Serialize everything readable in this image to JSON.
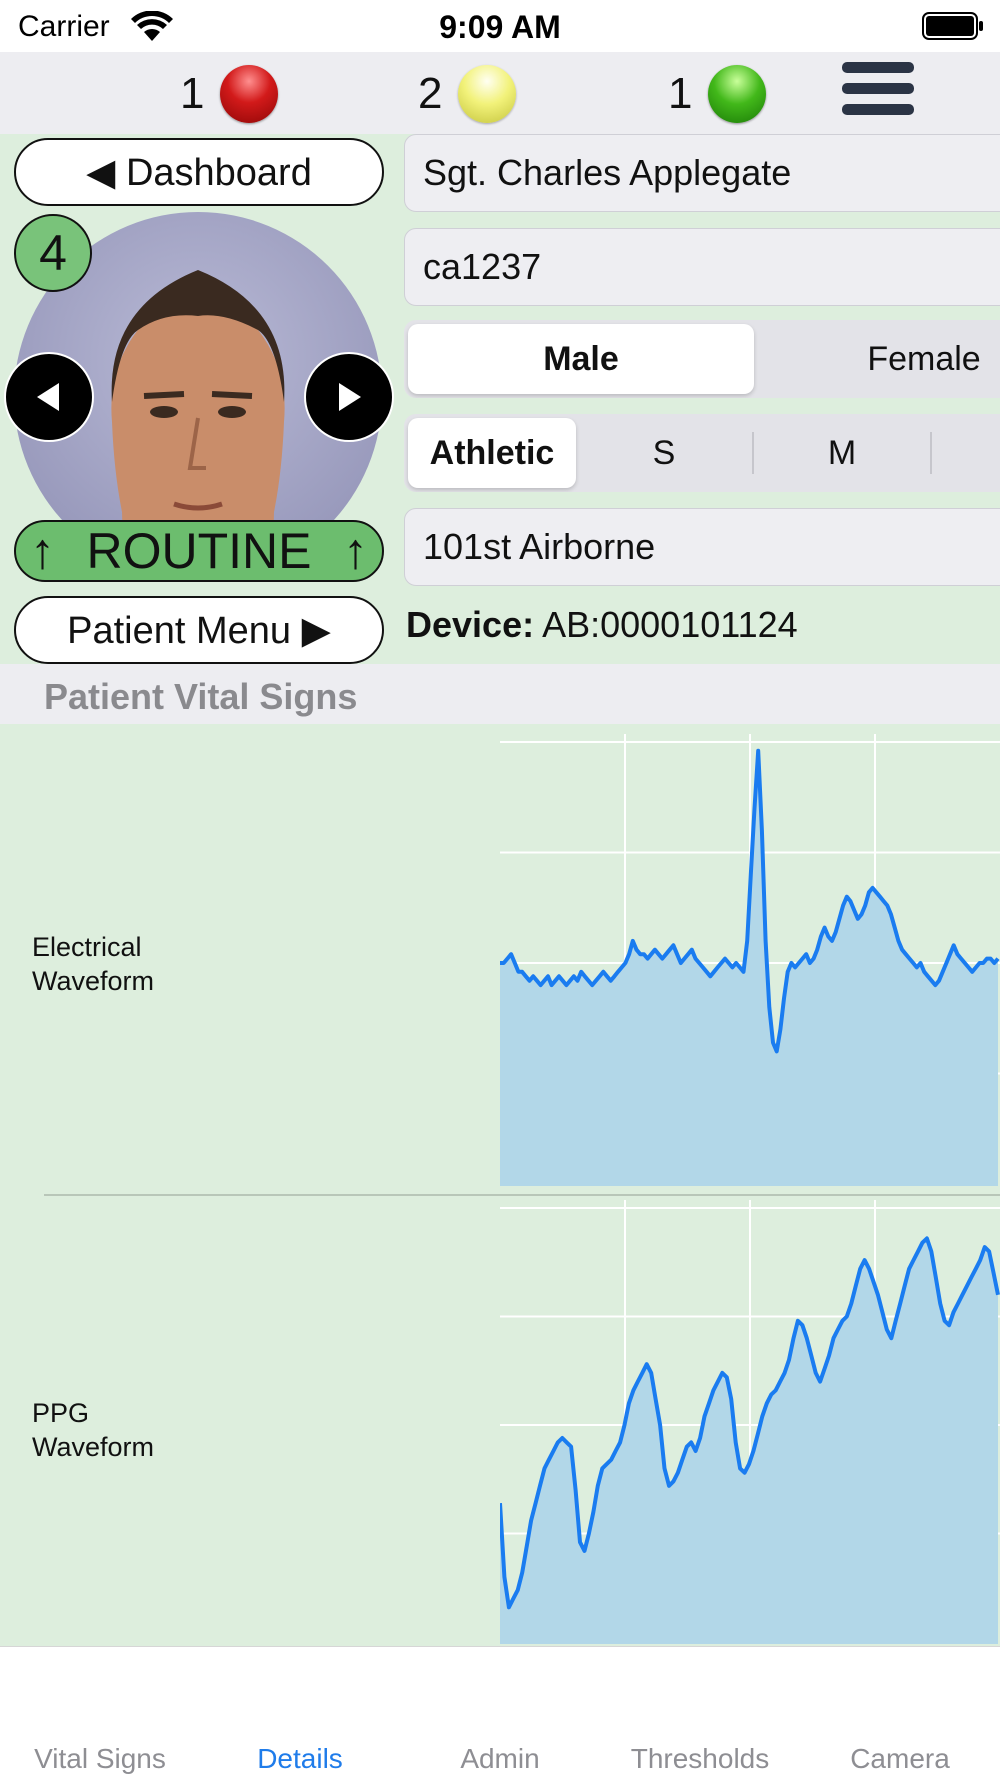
{
  "status_bar": {
    "carrier": "Carrier",
    "time": "9:09 AM"
  },
  "triage": {
    "items": [
      {
        "count": "1",
        "color": "red",
        "hex": "#d21a1a"
      },
      {
        "count": "2",
        "color": "yellow",
        "hex": "#f2f27a"
      },
      {
        "count": "1",
        "color": "green",
        "hex": "#42b81a"
      }
    ],
    "menu_icon": "hamburger-icon"
  },
  "patient": {
    "dashboard_button": "◀ Dashboard",
    "patient_count": "4",
    "prev_icon": "arrow-left-icon",
    "next_icon": "arrow-right-icon",
    "priority": {
      "arrow_left": "↑",
      "label": "ROUTINE",
      "arrow_right": "↑",
      "color": "#6cbd6e"
    },
    "menu_button": "Patient Menu ▶",
    "name": "Sgt. Charles Applegate",
    "patient_id": "ca1237",
    "sex_options": [
      "Male",
      "Female"
    ],
    "sex_selected": "Male",
    "build_options": [
      "Athletic",
      "S",
      "M"
    ],
    "build_selected": "Athletic",
    "unit": "101st Airborne",
    "device_label": "Device:",
    "device_value": "AB:0000101124"
  },
  "vitals": {
    "section_title": "Patient Vital Signs",
    "fill_color": "#b2d7e8",
    "line_color": "#1a7cf0"
  },
  "chart_data": [
    {
      "type": "area",
      "label_lines": [
        "Electrical",
        "Waveform"
      ],
      "ylim": [
        0,
        100
      ],
      "values": [
        50,
        50,
        51,
        52,
        50,
        48,
        48,
        47,
        46,
        47,
        46,
        45,
        46,
        47,
        45,
        46,
        47,
        46,
        45,
        46,
        47,
        46,
        48,
        47,
        46,
        45,
        46,
        47,
        48,
        47,
        46,
        47,
        48,
        49,
        50,
        52,
        55,
        53,
        52,
        52,
        51,
        52,
        53,
        52,
        51,
        52,
        53,
        54,
        52,
        50,
        51,
        52,
        53,
        51,
        50,
        49,
        48,
        47,
        48,
        49,
        50,
        51,
        50,
        49,
        50,
        49,
        48,
        55,
        70,
        85,
        98,
        80,
        55,
        40,
        32,
        30,
        35,
        42,
        48,
        50,
        49,
        50,
        51,
        52,
        50,
        51,
        53,
        56,
        58,
        56,
        55,
        57,
        60,
        63,
        65,
        64,
        62,
        60,
        61,
        63,
        66,
        67,
        66,
        65,
        64,
        63,
        61,
        58,
        55,
        53,
        52,
        51,
        50,
        49,
        50,
        48,
        47,
        46,
        45,
        46,
        48,
        50,
        52,
        54,
        52,
        51,
        50,
        49,
        48,
        49,
        50,
        50,
        51,
        51,
        50,
        51
      ]
    },
    {
      "type": "area",
      "label_lines": [
        "PPG",
        "Waveform"
      ],
      "ylim": [
        0,
        100
      ],
      "values": [
        32,
        15,
        8,
        10,
        12,
        16,
        22,
        28,
        32,
        36,
        40,
        42,
        44,
        46,
        47,
        46,
        45,
        35,
        23,
        21,
        25,
        30,
        36,
        40,
        41,
        42,
        44,
        46,
        50,
        55,
        58,
        60,
        62,
        64,
        62,
        56,
        50,
        40,
        36,
        37,
        39,
        42,
        45,
        46,
        44,
        47,
        52,
        55,
        58,
        60,
        62,
        61,
        56,
        46,
        40,
        39,
        41,
        44,
        48,
        52,
        55,
        57,
        58,
        60,
        62,
        65,
        70,
        74,
        73,
        70,
        66,
        62,
        60,
        63,
        66,
        70,
        72,
        74,
        75,
        78,
        82,
        86,
        88,
        86,
        83,
        80,
        76,
        72,
        70,
        74,
        78,
        82,
        86,
        88,
        90,
        92,
        93,
        90,
        84,
        78,
        74,
        73,
        76,
        78,
        80,
        82,
        84,
        86,
        88,
        91,
        90,
        85,
        80
      ]
    }
  ],
  "tabs": [
    {
      "label": "Vital Signs",
      "active": false
    },
    {
      "label": "Details",
      "active": true
    },
    {
      "label": "Admin",
      "active": false
    },
    {
      "label": "Thresholds",
      "active": false
    },
    {
      "label": "Camera",
      "active": false
    }
  ]
}
